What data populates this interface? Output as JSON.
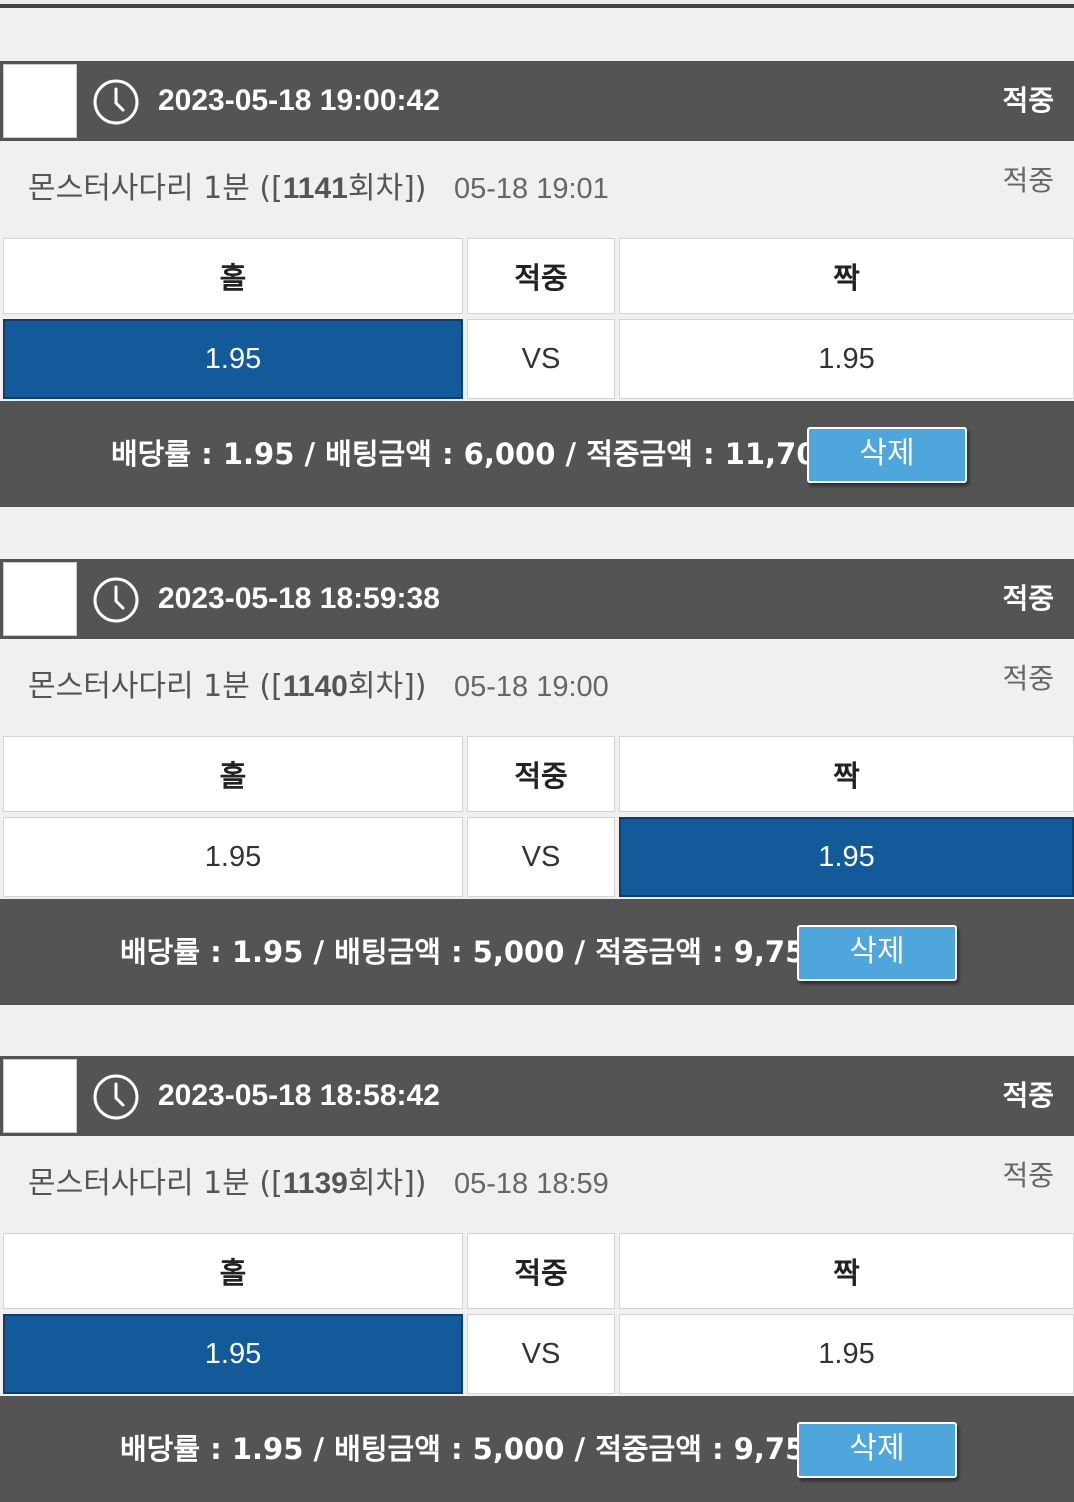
{
  "accent_selected": "#135a9a",
  "delete_button_color": "#4fa6dc",
  "header_bg": "#545454",
  "bets": [
    {
      "timestamp": "2023-05-18 19:00:42",
      "header_status": "적중",
      "game_prefix": "몬스터사다리 1분 ([",
      "round": "1141",
      "game_suffix": "회차])",
      "game_time": "05-18 19:01",
      "game_status": "적중",
      "columns": [
        "홀",
        "적중",
        "짝"
      ],
      "odds_left": "1.95",
      "vs": "VS",
      "odds_right": "1.95",
      "selected": "left",
      "summary": "배당률 : 1.95 / 배팅금액 : 6,000 / 적중금액 : 11,700",
      "delete_label": "삭제"
    },
    {
      "timestamp": "2023-05-18 18:59:38",
      "header_status": "적중",
      "game_prefix": "몬스터사다리 1분 ([",
      "round": "1140",
      "game_suffix": "회차])",
      "game_time": "05-18 19:00",
      "game_status": "적중",
      "columns": [
        "홀",
        "적중",
        "짝"
      ],
      "odds_left": "1.95",
      "vs": "VS",
      "odds_right": "1.95",
      "selected": "right",
      "summary": "배당률 : 1.95 / 배팅금액 : 5,000 / 적중금액 : 9,750",
      "delete_label": "삭제"
    },
    {
      "timestamp": "2023-05-18 18:58:42",
      "header_status": "적중",
      "game_prefix": "몬스터사다리 1분 ([",
      "round": "1139",
      "game_suffix": "회차])",
      "game_time": "05-18 18:59",
      "game_status": "적중",
      "columns": [
        "홀",
        "적중",
        "짝"
      ],
      "odds_left": "1.95",
      "vs": "VS",
      "odds_right": "1.95",
      "selected": "left",
      "summary": "배당률 : 1.95 / 배팅금액 : 5,000 / 적중금액 : 9,750",
      "delete_label": "삭제"
    }
  ]
}
